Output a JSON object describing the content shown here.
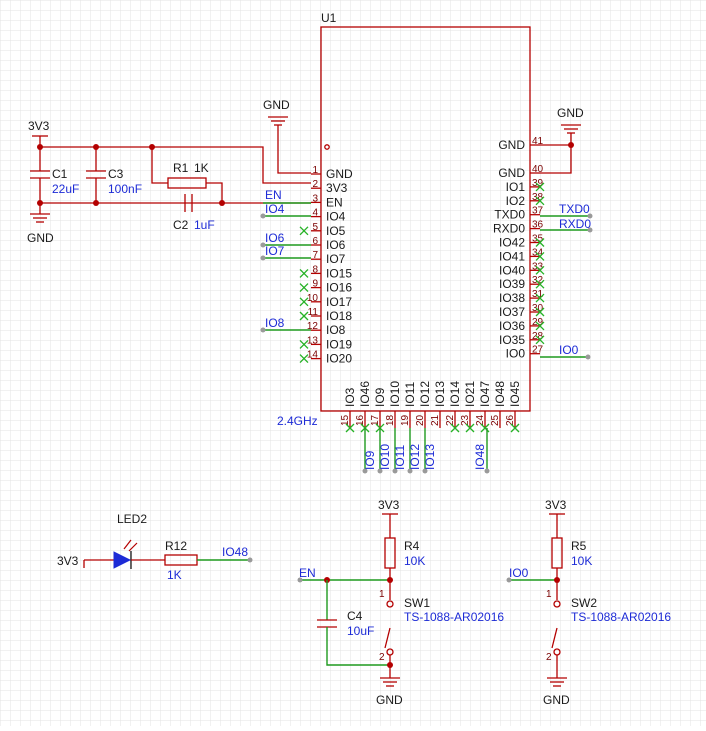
{
  "module": {
    "ref": "U1",
    "antenna": "2.4GHz",
    "left_pins": [
      {
        "num": "1",
        "name": "GND"
      },
      {
        "num": "2",
        "name": "3V3"
      },
      {
        "num": "3",
        "name": "EN"
      },
      {
        "num": "4",
        "name": "IO4"
      },
      {
        "num": "5",
        "name": "IO5"
      },
      {
        "num": "6",
        "name": "IO6"
      },
      {
        "num": "7",
        "name": "IO7"
      },
      {
        "num": "8",
        "name": "IO15"
      },
      {
        "num": "9",
        "name": "IO16"
      },
      {
        "num": "10",
        "name": "IO17"
      },
      {
        "num": "11",
        "name": "IO18"
      },
      {
        "num": "12",
        "name": "IO8"
      },
      {
        "num": "13",
        "name": "IO19"
      },
      {
        "num": "14",
        "name": "IO20"
      }
    ],
    "right_pins": [
      {
        "num": "41",
        "name": "GND"
      },
      {
        "num": "40",
        "name": "GND"
      },
      {
        "num": "39",
        "name": "IO1"
      },
      {
        "num": "38",
        "name": "IO2"
      },
      {
        "num": "37",
        "name": "TXD0"
      },
      {
        "num": "36",
        "name": "RXD0"
      },
      {
        "num": "35",
        "name": "IO42"
      },
      {
        "num": "34",
        "name": "IO41"
      },
      {
        "num": "33",
        "name": "IO40"
      },
      {
        "num": "32",
        "name": "IO39"
      },
      {
        "num": "31",
        "name": "IO38"
      },
      {
        "num": "30",
        "name": "IO37"
      },
      {
        "num": "29",
        "name": "IO36"
      },
      {
        "num": "28",
        "name": "IO35"
      },
      {
        "num": "27",
        "name": "IO0"
      }
    ],
    "bottom_pins": [
      {
        "num": "15",
        "name": "IO3"
      },
      {
        "num": "16",
        "name": "IO46"
      },
      {
        "num": "17",
        "name": "IO9"
      },
      {
        "num": "18",
        "name": "IO10"
      },
      {
        "num": "19",
        "name": "IO11"
      },
      {
        "num": "20",
        "name": "IO12"
      },
      {
        "num": "21",
        "name": "IO13"
      },
      {
        "num": "22",
        "name": "IO14"
      },
      {
        "num": "23",
        "name": "IO21"
      },
      {
        "num": "24",
        "name": "IO47"
      },
      {
        "num": "25",
        "name": "IO48"
      },
      {
        "num": "26",
        "name": "IO45"
      }
    ]
  },
  "net_labels": {
    "en": "EN",
    "io4": "IO4",
    "io6": "IO6",
    "io7": "IO7",
    "io8": "IO8",
    "txd0": "TXD0",
    "rxd0": "RXD0",
    "io0_right": "IO0",
    "io9": "IO9",
    "io10": "IO10",
    "io11": "IO11",
    "io12": "IO12",
    "io13": "IO13",
    "io48_bottom": "IO48",
    "io48_led": "IO48",
    "en_sw": "EN",
    "io0_sw": "IO0"
  },
  "power": {
    "vcc_top": "3V3",
    "gnd_top_left": "GND",
    "gnd_top_mid": "GND",
    "gnd_top_right": "GND",
    "vcc_led": "3V3",
    "vcc_r4": "3V3",
    "vcc_r5": "3V3",
    "gnd_sw1": "GND",
    "gnd_sw2": "GND"
  },
  "components": {
    "c1": {
      "ref": "C1",
      "value": "22uF"
    },
    "c3": {
      "ref": "C3",
      "value": "100nF"
    },
    "r1": {
      "ref": "R1",
      "value": "1K"
    },
    "c2": {
      "ref": "C2",
      "value": "1uF"
    },
    "led2": {
      "ref": "LED2"
    },
    "r12": {
      "ref": "R12",
      "value": "1K"
    },
    "r4": {
      "ref": "R4",
      "value": "10K"
    },
    "r5": {
      "ref": "R5",
      "value": "10K"
    },
    "c4": {
      "ref": "C4",
      "value": "10uF"
    },
    "sw1": {
      "ref": "SW1",
      "value": "TS-1088-AR02016",
      "pin1": "1",
      "pin2": "2"
    },
    "sw2": {
      "ref": "SW2",
      "value": "TS-1088-AR02016",
      "pin1": "1",
      "pin2": "2"
    }
  },
  "colors": {
    "body_outline": "#b40000",
    "wire": "#1e9a1e",
    "label": "#1d2bd6",
    "text": "#1a1a1a",
    "grid": "#e3e3e3"
  }
}
